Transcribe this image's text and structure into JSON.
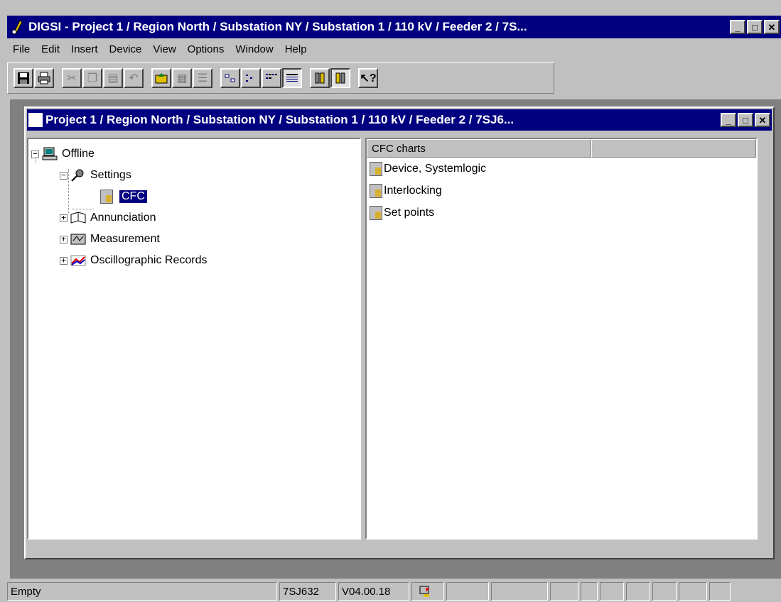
{
  "window": {
    "title": "DIGSI - Project 1 / Region North / Substation NY / Substation 1 / 110 kV / Feeder 2 / 7S...",
    "min": "_",
    "max": "□",
    "close": "✕"
  },
  "menu": {
    "file": "File",
    "edit": "Edit",
    "insert": "Insert",
    "device": "Device",
    "view": "View",
    "options": "Options",
    "window": "Window",
    "help": "Help"
  },
  "toolbar": {
    "buttons": [
      "save-icon",
      "print-icon",
      "cut-icon",
      "copy-icon",
      "paste-icon",
      "undo-icon",
      "up-folder-icon",
      "properties-icon",
      "align-icon",
      "large-icons",
      "small-icons",
      "list-view",
      "details-view",
      "device-online-icon",
      "device-offline-icon",
      "context-help-icon"
    ]
  },
  "child": {
    "title": "Project 1 / Region North / Substation NY / Substation 1 / 110 kV / Feeder 2 / 7SJ6...",
    "min": "_",
    "max": "□",
    "close": "✕"
  },
  "tree": {
    "offline": "Offline",
    "settings": "Settings",
    "cfc": "CFC",
    "annunciation": "Annunciation",
    "measurement": "Measurement",
    "oscillographic": "Oscillographic Records"
  },
  "list": {
    "column": "CFC charts",
    "items": [
      "Device, Systemlogic",
      "Interlocking",
      "Set points"
    ]
  },
  "status": {
    "text": "Empty",
    "device": "7SJ632",
    "version": "V04.00.18"
  }
}
